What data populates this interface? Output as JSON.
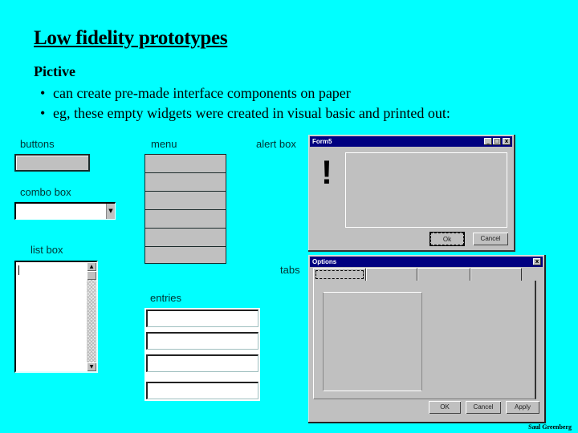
{
  "slide": {
    "title": "Low fidelity prototypes",
    "subtitle": "Pictive",
    "bullets": [
      "can create pre-made interface components on paper",
      "eg, these empty widgets were created in visual basic and printed out:"
    ],
    "footer": "Saul Greenberg"
  },
  "widget_labels": {
    "buttons": "buttons",
    "combo_box": "combo box",
    "list_box": "list box",
    "menu": "menu",
    "entries": "entries",
    "alert_box": "alert box",
    "tabs": "tabs"
  },
  "glyphs": {
    "bullet": "•",
    "dropdown_arrow": "▼",
    "scroll_up": "▲",
    "scroll_down": "▼",
    "minimize": "_",
    "maximize": "□",
    "close": "x",
    "exclaim": "!"
  },
  "alert_window": {
    "title": "Form5",
    "ok_label": "Ok",
    "cancel_label": "Cancel"
  },
  "tabs_window": {
    "title": "Options",
    "ok_label": "OK",
    "cancel_label": "Cancel",
    "apply_label": "Apply"
  },
  "menu": {
    "item_count": 6
  },
  "colors": {
    "background": "#00ffff",
    "widget_gray": "#c0c0c0",
    "titlebar": "#000080"
  }
}
